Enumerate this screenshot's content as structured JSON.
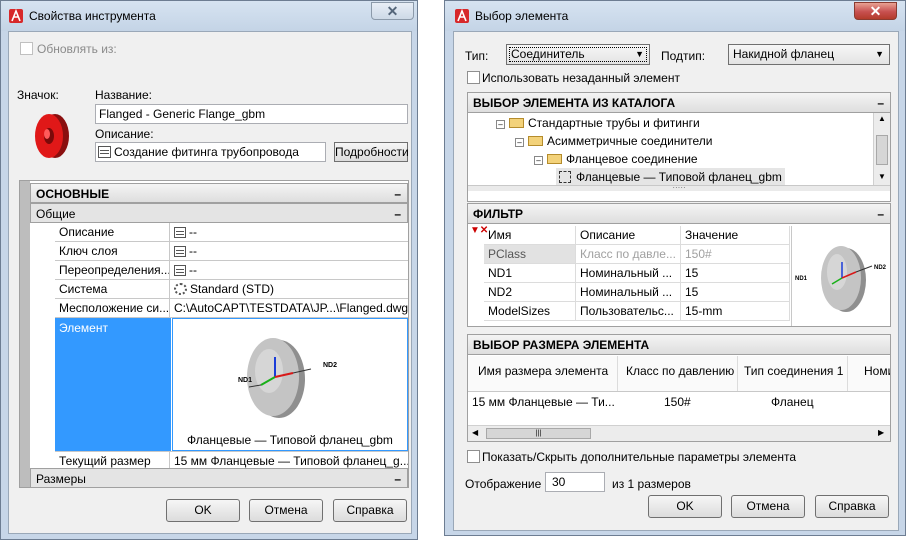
{
  "left_dialog": {
    "title": "Свойства инструмента",
    "update_from_label": "Обновлять из:",
    "icon_label": "Значок:",
    "name_label": "Название:",
    "name_value": "Flanged - Generic Flange_gbm",
    "description_label": "Описание:",
    "description_value": "Создание фитинга трубопровода",
    "details_button": "Подробности",
    "section_main": "ОСНОВНЫЕ",
    "subsection_general": "Общие",
    "properties": [
      {
        "name": "Описание",
        "value": "--"
      },
      {
        "name": "Ключ слоя",
        "value": "--"
      },
      {
        "name": "Переопределения...",
        "value": "--"
      },
      {
        "name": "Система",
        "value": "Standard (STD)"
      },
      {
        "name": "Месположение си...",
        "value": "C:\\AutoCAPT\\TESTDATA\\JP...\\Flanged.dwg"
      }
    ],
    "element_label": "Элемент",
    "element_caption": "Фланцевые — Типовой фланец_gbm",
    "preview_nd1": "ND1",
    "preview_nd2": "ND2",
    "current_size_label": "Текущий размер",
    "current_size_value": "15 мм Фланцевые — Типовой фланец_g...",
    "section_sizes": "Размеры",
    "ok": "OK",
    "cancel": "Отмена",
    "help": "Справка"
  },
  "right_dialog": {
    "title": "Выбор элемента",
    "type_label": "Тип:",
    "type_value": "Соединитель",
    "subtype_label": "Подтип:",
    "subtype_value": "Накидной фланец",
    "use_unset_label": "Использовать незаданный элемент",
    "catalog_header": "ВЫБОР ЭЛЕМЕНТА ИЗ КАТАЛОГА",
    "tree": [
      "Стандартные трубы и фитинги",
      "Асимметричные соединители",
      "Фланцевое соединение",
      "Фланцевые — Типовой фланец_gbm"
    ],
    "filter_header": "ФИЛЬТР",
    "filter_columns": [
      "Имя",
      "Описание",
      "Значение"
    ],
    "filter_rows": [
      {
        "name": "PClass",
        "desc": "Класс по давле...",
        "value": "150#"
      },
      {
        "name": "ND1",
        "desc": "Номинальный ...",
        "value": "15"
      },
      {
        "name": "ND2",
        "desc": "Номинальный ...",
        "value": "15"
      },
      {
        "name": "ModelSizes",
        "desc": "Пользовательс...",
        "value": "15-mm"
      }
    ],
    "preview_nd1": "ND1",
    "preview_nd2": "ND2",
    "size_header": "ВЫБОР РАЗМЕРА ЭЛЕМЕНТА",
    "size_columns": [
      "Имя размера элемента",
      "Класс по давлению",
      "Тип соединения 1",
      "Номи"
    ],
    "size_rows": [
      {
        "name": "15 мм Фланцевые — Ти...",
        "class": "150#",
        "conn": "Фланец"
      }
    ],
    "show_hide_label": "Показать/Скрыть дополнительные параметры элемента",
    "display_label": "Отображение",
    "display_value": "30",
    "display_of": "из 1 размеров",
    "ok": "OK",
    "cancel": "Отмена",
    "help": "Справка"
  },
  "colors": {
    "selection": "#3399ff",
    "title_bar": "#c7d6e8",
    "close_red": "#c75050",
    "app_red": "#d7282a"
  }
}
